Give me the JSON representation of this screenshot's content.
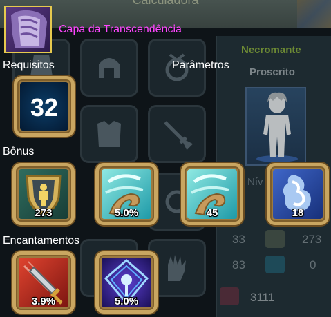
{
  "background": {
    "title": "Calculadora",
    "panel": {
      "class_name": "Necromante",
      "subclass": "Proscrito",
      "level_label": "Nív",
      "stats": [
        {
          "left": "33",
          "right": "273"
        },
        {
          "left": "83",
          "right": "0"
        }
      ],
      "total": "3111"
    }
  },
  "item": {
    "name": "Capa da Transcendência",
    "level_badge": "32"
  },
  "sections": {
    "requirements": "Requisitos",
    "parameters": "Parâmetros",
    "bonus": "Bônus",
    "enchantments": "Encantamentos"
  },
  "requirement_level": "32",
  "bonuses": [
    {
      "icon": "armor-shield-icon",
      "value": "273"
    },
    {
      "icon": "crescent-wind-icon",
      "value": "5.0%"
    },
    {
      "icon": "crescent-wind-icon",
      "value": "45"
    },
    {
      "icon": "water-swirl-icon",
      "value": "18"
    }
  ],
  "enchantments": [
    {
      "icon": "sword-strike-icon",
      "value": "3.9%"
    },
    {
      "icon": "arcane-rune-icon",
      "value": "5.0%"
    }
  ],
  "colors": {
    "item_name": "#ff46ff",
    "class_name": "#6d8a34",
    "gold_frame": "#c9a661",
    "background": "#0e1418"
  }
}
